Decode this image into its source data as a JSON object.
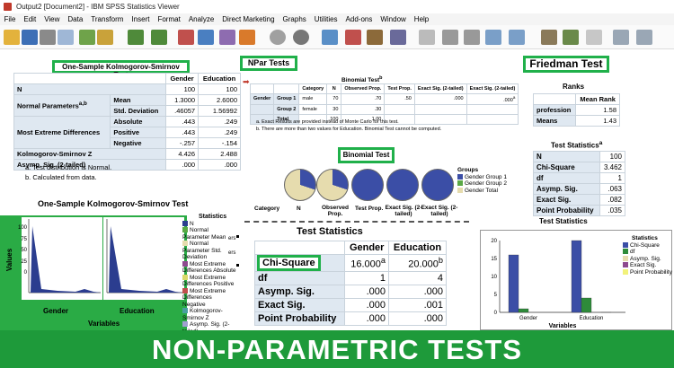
{
  "window": {
    "title": "Output2 [Document2] - IBM SPSS Statistics Viewer"
  },
  "menu": [
    "File",
    "Edit",
    "View",
    "Data",
    "Transform",
    "Insert",
    "Format",
    "Analyze",
    "Direct Marketing",
    "Graphs",
    "Utilities",
    "Add-ons",
    "Window",
    "Help"
  ],
  "ks": {
    "label": "One-Sample Kolmogorov-Smirnov Test",
    "headers": [
      "",
      "",
      "Gender",
      "Education"
    ],
    "rows": [
      {
        "a": "N",
        "b": "",
        "g": "100",
        "e": "100"
      },
      {
        "a": "Normal Parameters",
        "sup": "a,b",
        "b": "Mean",
        "g": "1.3000",
        "e": "2.6000"
      },
      {
        "a": "",
        "b": "Std. Deviation",
        "g": ".46057",
        "e": "1.56992"
      },
      {
        "a": "Most Extreme Differences",
        "b": "Absolute",
        "g": ".443",
        "e": ".249"
      },
      {
        "a": "",
        "b": "Positive",
        "g": ".443",
        "e": ".249"
      },
      {
        "a": "",
        "b": "Negative",
        "g": "-.257",
        "e": "-.154"
      },
      {
        "a": "Kolmogorov-Smirnov Z",
        "b": "",
        "g": "4.426",
        "e": "2.488"
      },
      {
        "a": "Asymp. Sig. (2-tailed)",
        "b": "",
        "g": ".000",
        "e": ".000"
      }
    ],
    "notes": [
      "a. Test distribution is Normal.",
      "b. Calculated from data."
    ]
  },
  "npar": {
    "label": "NPar Tests",
    "binomial_title": "Binomial Test",
    "binomial_title_sup": "b",
    "headers": [
      "",
      "",
      "Category",
      "N",
      "Observed Prop.",
      "Test Prop.",
      "Exact Sig. (2-tailed)",
      "Exact Sig. (2-tailed)"
    ],
    "rows": [
      [
        "Gender",
        "Group 1",
        "male",
        "70",
        ".70",
        ".50",
        ".000",
        ".000"
      ],
      [
        "",
        "Group 2",
        "female",
        "30",
        ".30",
        "",
        "",
        ""
      ],
      [
        "",
        "Total",
        "",
        "100",
        "1.00",
        "",
        "",
        ""
      ]
    ],
    "row0_sup": "a",
    "notes": [
      "a. Exact Results are provided instead of Monte Carlo for this test.",
      "b. There are more than two values for Education. Binomial Test cannot be computed."
    ]
  },
  "friedman": {
    "label": "Friedman Test",
    "ranks_title": "Ranks",
    "ranks_header": "Mean Rank",
    "ranks": [
      {
        "name": "profession",
        "value": "1.58"
      },
      {
        "name": "Means",
        "value": "1.43"
      }
    ],
    "stats_title": "Test Statistics",
    "stats_title_sup": "a",
    "stats": [
      {
        "name": "N",
        "value": "100"
      },
      {
        "name": "Chi-Square",
        "value": "3.462"
      },
      {
        "name": "df",
        "value": "1"
      },
      {
        "name": "Asymp. Sig.",
        "value": ".063"
      },
      {
        "name": "Exact Sig.",
        "value": ".082"
      },
      {
        "name": "Point Probability",
        "value": ".035"
      }
    ]
  },
  "binomial_chart": {
    "label": "Binomial Test",
    "columns": [
      "Category",
      "N",
      "Observed Prop.",
      "Test Prop.",
      "Exact Sig. (2-tailed)",
      "Exact Sig. (2-tailed)"
    ],
    "legend_title": "Groups",
    "legend": [
      "Gender Group 1",
      "Gender Group 2",
      "Gender Total"
    ]
  },
  "test_stats": {
    "title": "Test Statistics",
    "headers": [
      "",
      "Gender",
      "Education"
    ],
    "rows": [
      {
        "name": "Chi-Square",
        "g": "16.000",
        "gs": "a",
        "e": "20.000",
        "es": "b"
      },
      {
        "name": "df",
        "g": "1",
        "gs": "",
        "e": "4",
        "es": ""
      },
      {
        "name": "Asymp. Sig.",
        "g": ".000",
        "gs": "",
        "e": ".000",
        "es": ""
      },
      {
        "name": "Exact Sig.",
        "g": ".000",
        "gs": "",
        "e": ".001",
        "es": ""
      },
      {
        "name": "Point Probability",
        "g": ".000",
        "gs": "",
        "e": ".000",
        "es": ""
      }
    ]
  },
  "ks_chart": {
    "title": "One-Sample Kolmogorov-Smirnov Test",
    "legend_title": "Statistics",
    "legend": [
      "N",
      "Normal Parameter Mean",
      "Normal Parameter Std. Deviation",
      "Most Extreme Differences Absolute",
      "Most Extreme Differences Positive",
      "Most Extreme Differences Negative",
      "Kolmogorov-Smirnov Z",
      "Asymp. Sig. (2-tailed)"
    ],
    "ylabel": "Values",
    "xlabel": "Variables",
    "categories": [
      "Gender",
      "Education"
    ],
    "yticks": [
      "0",
      "25",
      "50",
      "75",
      "100"
    ],
    "overflow_suffix": "ers"
  },
  "stats_chart": {
    "title": "Test Statistics",
    "legend_title": "Statistics",
    "legend": [
      "Chi-Square",
      "df",
      "Asymp. Sig.",
      "Exact Sig.",
      "Point Probability"
    ],
    "xlabel": "Variables",
    "categories": [
      "Gender",
      "Education"
    ],
    "yticks": [
      "0",
      "5",
      "10",
      "15",
      "20"
    ]
  },
  "chart_data": [
    {
      "type": "bar",
      "title": "Test Statistics",
      "xlabel": "Variables",
      "ylabel": "",
      "categories": [
        "Gender",
        "Education"
      ],
      "ylim": [
        0,
        20
      ],
      "series": [
        {
          "name": "Chi-Square",
          "values": [
            16,
            20
          ]
        },
        {
          "name": "df",
          "values": [
            1,
            4
          ]
        },
        {
          "name": "Asymp. Sig.",
          "values": [
            0,
            0
          ]
        },
        {
          "name": "Exact Sig.",
          "values": [
            0,
            0.001
          ]
        },
        {
          "name": "Point Probability",
          "values": [
            0,
            0
          ]
        }
      ]
    }
  ],
  "banner": {
    "text": "NON-PARAMETRIC TESTS"
  },
  "colors": {
    "accent_green": "#20b04a",
    "banner_green": "#1e9a3a",
    "blue": "#3b4ea6",
    "green": "#5aa845",
    "tan": "#e6dcae",
    "header_fill": "#dfe8f1"
  }
}
